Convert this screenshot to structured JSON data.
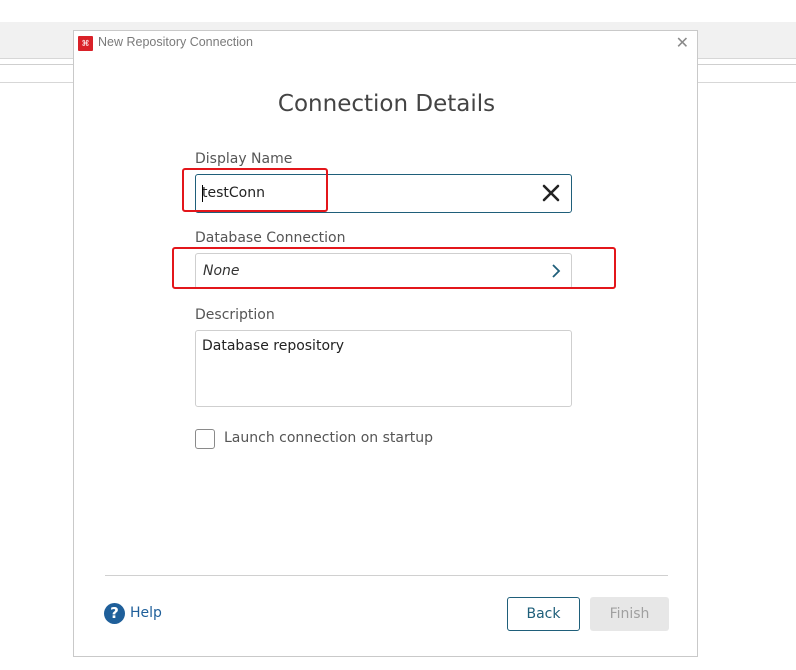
{
  "window": {
    "title": "New Repository Connection"
  },
  "heading": "Connection Details",
  "display_name": {
    "label": "Display Name",
    "value": "testConn"
  },
  "database_connection": {
    "label": "Database Connection",
    "value": "None"
  },
  "description": {
    "label": "Description",
    "value": "Database repository"
  },
  "launch_on_startup": {
    "label": "Launch connection on startup",
    "checked": false
  },
  "footer": {
    "help_label": "Help",
    "back_label": "Back",
    "finish_label": "Finish"
  },
  "colors": {
    "accent": "#1f5f7a",
    "highlight": "#e3161b",
    "app_icon": "#d92128",
    "help": "#1f5f9a"
  },
  "icons": {
    "app": "app-logo-icon",
    "close": "close-icon",
    "clear": "clear-icon",
    "chevron": "chevron-right-icon",
    "help": "help-icon"
  }
}
